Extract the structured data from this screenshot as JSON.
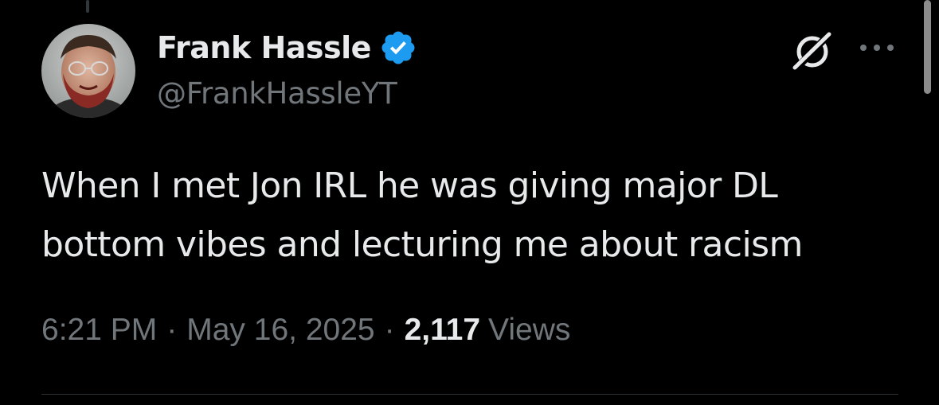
{
  "tweet": {
    "author": {
      "display_name": "Frank Hassle",
      "handle": "@FrankHassleYT",
      "verified": true,
      "verified_icon": "verified-badge-icon",
      "avatar_icon": "avatar"
    },
    "text_line_1": "When I met Jon IRL he was giving major DL",
    "text_line_2": "bottom vibes and lecturing me about racism",
    "time": "6:21 PM",
    "date": "May 16, 2025",
    "separator": "·",
    "views_count": "2,117",
    "views_label": "Views"
  },
  "actions": {
    "grok_icon": "grok-icon",
    "more_icon": "more-options-icon"
  },
  "colors": {
    "background": "#000000",
    "primary_text": "#e7e9ea",
    "secondary_text": "#71767b",
    "verified_blue": "#1d9bf0",
    "divider": "#2f3336"
  }
}
